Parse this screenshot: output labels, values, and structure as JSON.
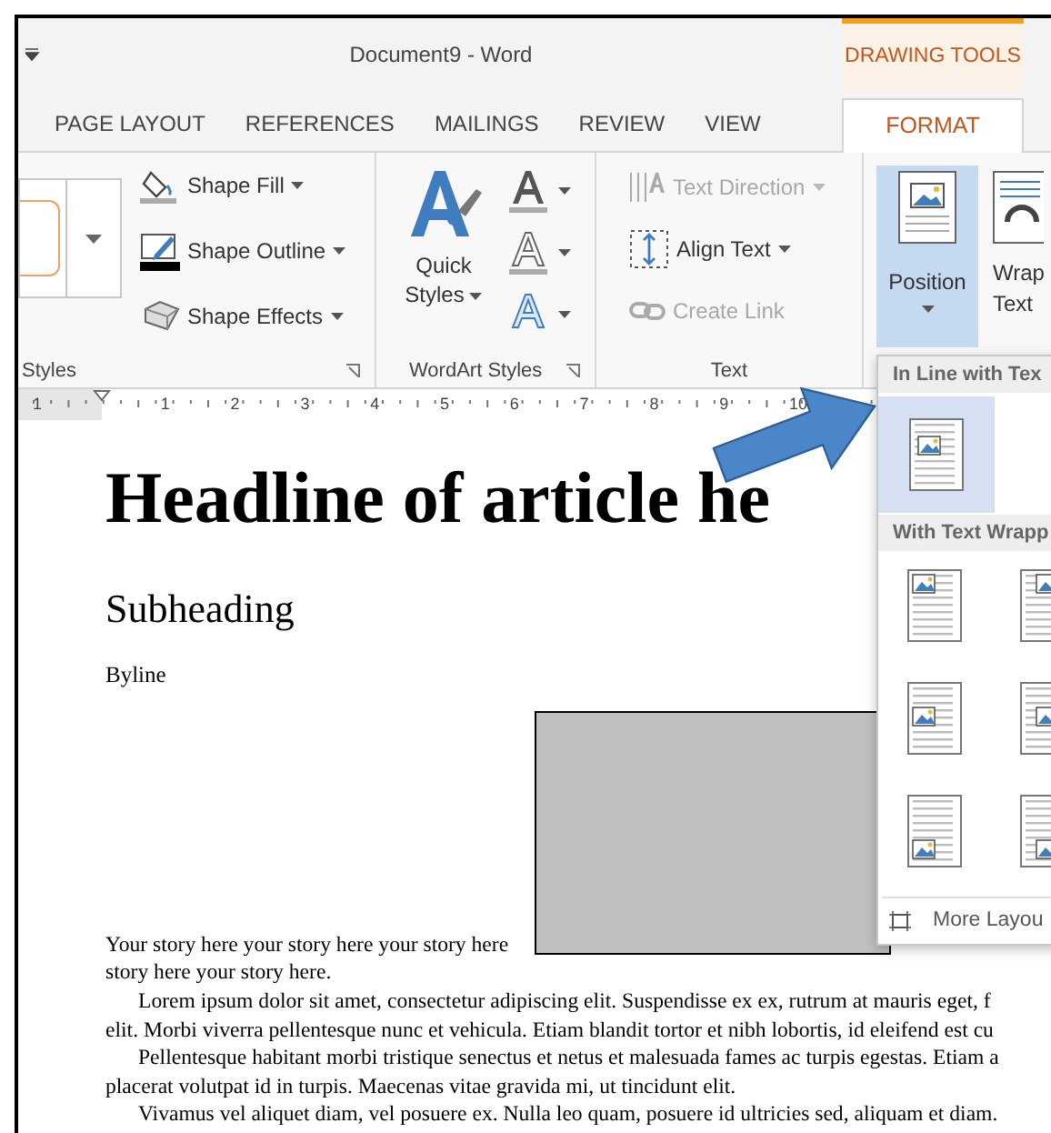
{
  "window": {
    "title": "Document9 - Word",
    "context_label": "DRAWING TOOLS"
  },
  "tabs": [
    {
      "label": "PAGE LAYOUT",
      "selected": false
    },
    {
      "label": "REFERENCES",
      "selected": false
    },
    {
      "label": "MAILINGS",
      "selected": false
    },
    {
      "label": "REVIEW",
      "selected": false
    },
    {
      "label": "VIEW",
      "selected": false
    },
    {
      "label": "FORMAT",
      "selected": true
    }
  ],
  "ribbon": {
    "shape_styles": {
      "label": "Styles",
      "commands": [
        {
          "label": "Shape Fill"
        },
        {
          "label": "Shape Outline"
        },
        {
          "label": "Shape Effects"
        }
      ]
    },
    "wordart_styles": {
      "label": "WordArt Styles",
      "quick_styles": "Quick Styles"
    },
    "text": {
      "label": "Text",
      "commands": [
        {
          "label": "Text Direction",
          "disabled": true
        },
        {
          "label": "Align Text",
          "disabled": false
        },
        {
          "label": "Create Link",
          "disabled": true
        }
      ]
    },
    "arrange": {
      "position": {
        "label": "Position",
        "selected": true
      },
      "wrap_text": {
        "label": "Wrap Text"
      }
    }
  },
  "ruler": {
    "numbers": [
      "1",
      "1",
      "2",
      "3",
      "4",
      "5",
      "6",
      "7",
      "8",
      "9",
      "10"
    ]
  },
  "document": {
    "headline": "Headline of article he",
    "subheading": "Subheading",
    "byline": "Byline",
    "lines": [
      {
        "text": "Your story here your story here your story here",
        "indent": false
      },
      {
        "text": "story here your story here.",
        "indent": false
      },
      {
        "text": "Lorem ipsum dolor sit amet, consectetur adipiscing elit. Suspendisse ex ex, rutrum at mauris eget, f",
        "indent": true
      },
      {
        "text": "elit. Morbi viverra pellentesque nunc et vehicula. Etiam blandit tortor et nibh lobortis, id eleifend est cu",
        "indent": false
      },
      {
        "text": "Pellentesque habitant morbi tristique senectus et netus et malesuada fames ac turpis egestas. Etiam a",
        "indent": true
      },
      {
        "text": "placerat volutpat id in turpis. Maecenas vitae gravida mi, ut tincidunt elit.",
        "indent": false
      },
      {
        "text": "Vivamus vel aliquet diam, vel posuere ex. Nulla leo quam, posuere id ultricies sed, aliquam et diam.",
        "indent": true
      }
    ]
  },
  "position_menu": {
    "sections": [
      {
        "heading": "In Line with Tex",
        "options": [
          {
            "selected": true
          }
        ]
      },
      {
        "heading": "With Text Wrapp",
        "options": [
          {
            "selected": false
          },
          {
            "selected": false
          },
          {
            "selected": false
          },
          {
            "selected": false
          },
          {
            "selected": false
          },
          {
            "selected": false
          }
        ]
      }
    ],
    "more": "More Layou"
  }
}
